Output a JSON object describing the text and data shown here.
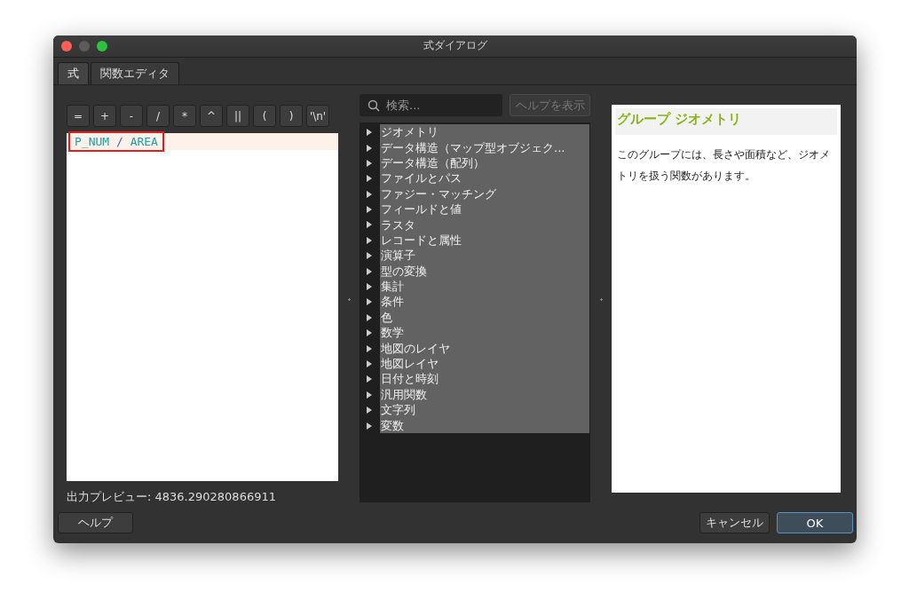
{
  "window": {
    "title": "式ダイアログ"
  },
  "tabs": [
    {
      "label": "式",
      "selected": true
    },
    {
      "label": "関数エディタ",
      "selected": false
    }
  ],
  "operator_buttons": [
    "=",
    "+",
    "-",
    "/",
    "*",
    "^",
    "||",
    "(",
    ")",
    "'\\n'"
  ],
  "expression": {
    "highlighted": true,
    "tokens": [
      {
        "text": "P_NUM",
        "kind": "field"
      },
      {
        "text": "/",
        "kind": "operator"
      },
      {
        "text": "AREA",
        "kind": "field"
      }
    ]
  },
  "output_preview": "出力プレビュー: 4836.290280866911",
  "search": {
    "placeholder": "検索..."
  },
  "show_help_button": {
    "label": "ヘルプを表示",
    "disabled": true
  },
  "function_groups": [
    {
      "label": "ジオメトリ",
      "selected": true
    },
    {
      "label": "データ構造（マップ型オブジェク...",
      "selected": true
    },
    {
      "label": "データ構造（配列）",
      "selected": true
    },
    {
      "label": "ファイルとパス",
      "selected": true
    },
    {
      "label": "ファジー・マッチング",
      "selected": true
    },
    {
      "label": "フィールドと値",
      "selected": true
    },
    {
      "label": "ラスタ",
      "selected": true
    },
    {
      "label": "レコードと属性",
      "selected": true
    },
    {
      "label": "演算子",
      "selected": true
    },
    {
      "label": "型の変換",
      "selected": true
    },
    {
      "label": "集計",
      "selected": true
    },
    {
      "label": "条件",
      "selected": true
    },
    {
      "label": "色",
      "selected": true
    },
    {
      "label": "数学",
      "selected": true
    },
    {
      "label": "地図のレイヤ",
      "selected": true
    },
    {
      "label": "地図レイヤ",
      "selected": true
    },
    {
      "label": "日付と時刻",
      "selected": true
    },
    {
      "label": "汎用関数",
      "selected": true
    },
    {
      "label": "文字列",
      "selected": true
    },
    {
      "label": "変数",
      "selected": true
    }
  ],
  "help_panel": {
    "title": "グループ ジオメトリ",
    "text": "このグループには、長さや面積など、ジオメトリを扱う関数があります。"
  },
  "buttons": {
    "help": "ヘルプ",
    "cancel": "キャンセル",
    "ok": "OK"
  }
}
